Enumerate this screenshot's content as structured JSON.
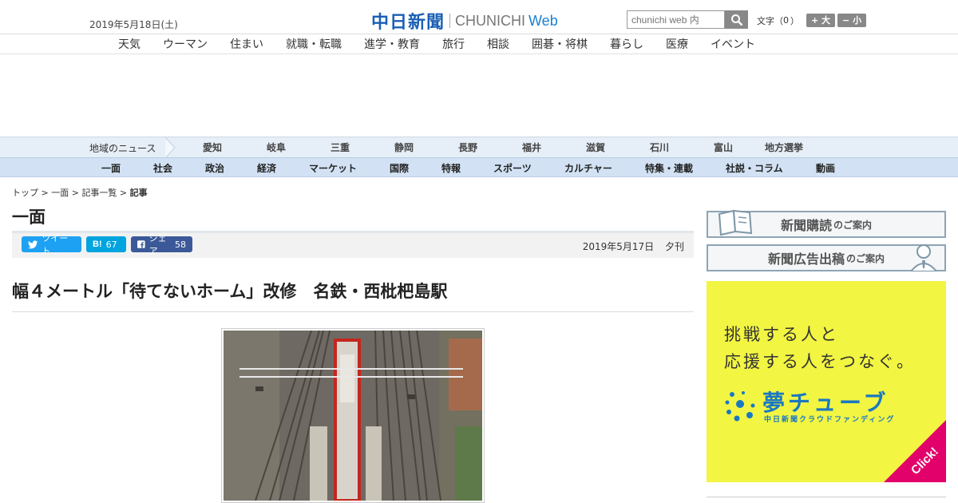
{
  "header": {
    "date": "2019年5月18日(土)",
    "logo_jp": "中日新聞",
    "logo_en": "CHUNICHI",
    "logo_web": "Web",
    "search_placeholder": "chunichi web 内",
    "font_label": "文字（",
    "font_count": "0",
    "font_close": "）",
    "font_larger": "+ 大",
    "font_smaller": "− 小"
  },
  "main_nav": [
    "天気",
    "ウーマン",
    "住まい",
    "就職・転職",
    "進学・教育",
    "旅行",
    "相談",
    "囲碁・将棋",
    "暮らし",
    "医療",
    "イベント"
  ],
  "region_nav": {
    "label": "地域のニュース",
    "items": [
      "愛知",
      "岐阜",
      "三重",
      "静岡",
      "長野",
      "福井",
      "滋賀",
      "石川",
      "富山",
      "地方選挙"
    ]
  },
  "category_nav": [
    "一面",
    "社会",
    "政治",
    "経済",
    "マーケット",
    "国際",
    "特報",
    "スポーツ",
    "カルチャー",
    "特集・連載",
    "社説・コラム",
    "動画"
  ],
  "breadcrumb": {
    "top": "トップ",
    "sep": " > ",
    "section": "一面",
    "list": "記事一覧",
    "current": "記事"
  },
  "section_title": "一面",
  "share": {
    "tweet": "ツイート",
    "hatena_count": "67",
    "facebook_label": "シェア",
    "facebook_count": "58"
  },
  "article": {
    "pub_date": "2019年5月17日",
    "edition": "夕刊",
    "headline": "幅４メートル「待てないホーム」改修　名鉄・西枇杷島駅"
  },
  "sidebar": {
    "banner1_main": "新聞購読",
    "banner1_sub": "のご案内",
    "banner2_main": "新聞広告出稿",
    "banner2_sub": "のご案内",
    "ad_line1": "挑戦する人と",
    "ad_line2": "応援する人をつなぐ。",
    "ad_brand": "夢チューブ",
    "ad_sub": "中日新聞クラウドファンディング",
    "ad_click": "Click!"
  },
  "colors": {
    "brand_blue": "#1a5fb4",
    "region_bg": "#e6eef7",
    "category_bg": "#d2e2f4",
    "ad_yellow": "#f2f542",
    "ad_pink": "#e2006a",
    "twitter": "#1da1f2",
    "hatena": "#00a4de",
    "facebook": "#3b5998"
  }
}
